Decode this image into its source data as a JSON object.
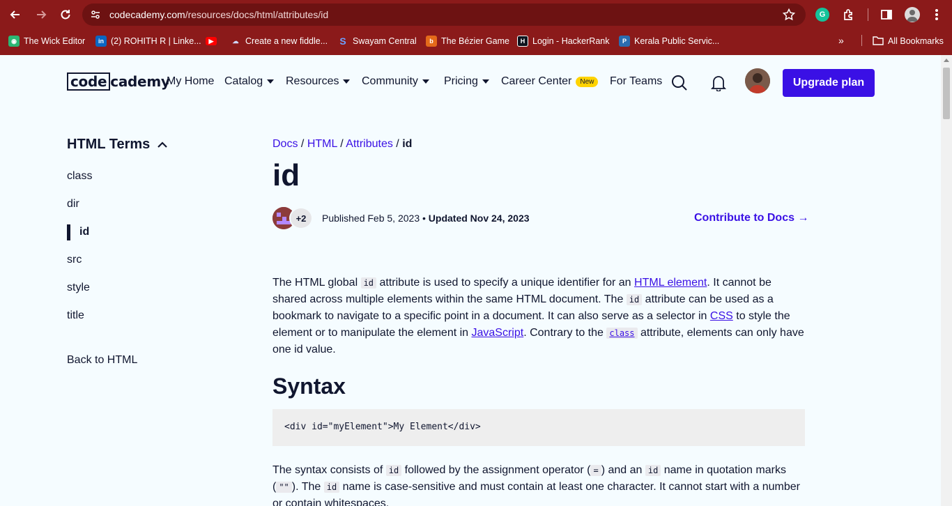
{
  "browser": {
    "url_host": "codecademy.com",
    "url_path": "/resources/docs/html/attributes/id",
    "bookmarks": [
      {
        "label": "The Wick Editor",
        "icon": "wick-icon",
        "color": "#2bb673"
      },
      {
        "label": "(2) ROHITH R | Linke...",
        "icon": "linkedin-icon",
        "color": "#0a66c2"
      },
      {
        "label": "",
        "icon": "youtube-icon",
        "color": "#ff0000"
      },
      {
        "label": "Create a new fiddle...",
        "icon": "jsfiddle-icon",
        "color": "#8aa4ff"
      },
      {
        "label": "Swayam Central",
        "icon": "swayam-icon",
        "color": "#2f6bd6"
      },
      {
        "label": "The Bézier Game",
        "icon": "bezier-game-icon",
        "color": "#e46a1a"
      },
      {
        "label": "Login - HackerRank",
        "icon": "hackerrank-icon",
        "color": "#0e141e"
      },
      {
        "label": "Kerala Public Servic...",
        "icon": "kpsc-icon",
        "color": "#2b6cb0"
      }
    ],
    "all_bookmarks": "All Bookmarks",
    "grammarly_letter": "G"
  },
  "header": {
    "logo_boxed": "code",
    "logo_rest": "cademy",
    "nav": {
      "my_home": "My Home",
      "catalog": "Catalog",
      "resources": "Resources",
      "community": "Community",
      "pricing": "Pricing",
      "career_center": "Career Center",
      "new_badge": "New",
      "for_teams": "For Teams"
    },
    "upgrade": "Upgrade plan"
  },
  "sidebar": {
    "title": "HTML Terms",
    "items": [
      "class",
      "dir",
      "id",
      "src",
      "style",
      "title"
    ],
    "active": "id",
    "back": "Back to HTML"
  },
  "main": {
    "breadcrumb": {
      "docs": "Docs",
      "html": "HTML",
      "attributes": "Attributes",
      "current": "id",
      "sep": "/"
    },
    "title": "id",
    "contributors_extra": "+2",
    "published": "Published Feb 5, 2023",
    "updated": "Updated Nov 24, 2023",
    "contribute": "Contribute to Docs →",
    "intro": {
      "t1": "The HTML global ",
      "c1": "id",
      "t2": " attribute is used to specify a unique identifier for an ",
      "l1": "HTML element",
      "t3": ". It cannot be shared across multiple elements within the same HTML document. The ",
      "c2": "id",
      "t4": " attribute can be used as a bookmark to navigate to a specific point in a document. It can also serve as a selector in ",
      "l2": "CSS",
      "t5": " to style the element or to manipulate the element in ",
      "l3": "JavaScript",
      "t6": ". Contrary to the ",
      "c3": "class",
      "t7": " attribute, elements can only have one id value."
    },
    "syntax_heading": "Syntax",
    "code": "<div id=\"myElement\">My Element</div>",
    "syntax_para": {
      "t1": "The syntax consists of ",
      "c1": "id",
      "t2": " followed by the assignment operator (",
      "c2": "=",
      "t3": ") and an ",
      "c3": "id",
      "t4": " name in quotation marks (",
      "c4": "\"\"",
      "t5": "). The ",
      "c5": "id",
      "t6": " name is case-sensitive and must contain at least one character. It cannot start with a number or contain whitespaces."
    }
  }
}
